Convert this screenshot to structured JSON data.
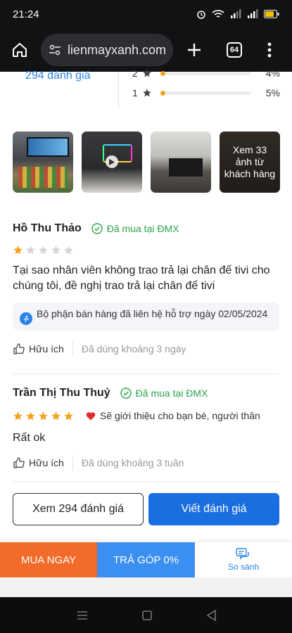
{
  "status_bar": {
    "time": "21:24"
  },
  "browser": {
    "url": "lienmayxanh.com",
    "tab_count": "64"
  },
  "rating_summary": {
    "total_reviews": "294 đánh giá",
    "rows": [
      {
        "stars": "2",
        "percent": "4%",
        "fill": 0.04
      },
      {
        "stars": "1",
        "percent": "5%",
        "fill": 0.05
      }
    ]
  },
  "photos": {
    "more_label": "Xem 33 ảnh từ khách hàng"
  },
  "reviews": [
    {
      "name": "Hồ Thu Thảo",
      "verified": "Đã mua tại ĐMX",
      "rating": 1,
      "text": "Tại sao nhân viên không trao trả lại chân đế tivi cho chúng tôi, đề nghị trao trả lại chân đế tivi",
      "support": "Bộ phận bán hàng đã liên hệ hỗ trợ ngày 02/05/2024",
      "helpful": "Hữu ích",
      "used": "Đã dùng khoảng 3 ngày"
    },
    {
      "name": "Trần Thị Thu Thuỷ",
      "verified": "Đã mua tại ĐMX",
      "rating": 5,
      "recommend": "Sẽ giới thiệu cho bạn bè, người thân",
      "text": "Rất ok",
      "helpful": "Hữu ích",
      "used": "Đã dùng khoảng 3 tuần"
    }
  ],
  "buttons": {
    "view_all": "Xem 294 đánh giá",
    "write": "Viết đánh giá"
  },
  "bottom_bar": {
    "buy_now": "MUA NGAY",
    "installment": "TRẢ GÓP 0%",
    "compare": "So sánh"
  },
  "colors": {
    "star": "#f4a21b",
    "verified": "#2ba24c",
    "primary": "#1a6fe0",
    "buy": "#f26b2b",
    "installment": "#3a8ff0",
    "link": "#2a83e9"
  }
}
